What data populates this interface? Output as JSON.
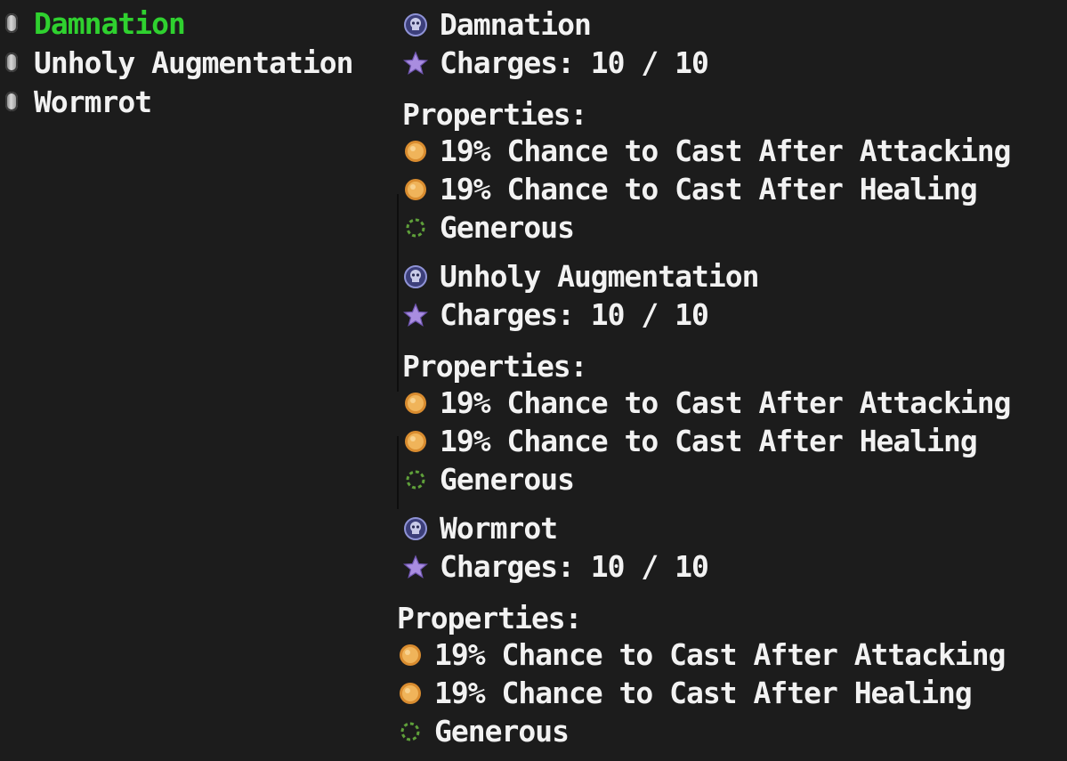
{
  "sidebar": {
    "items": [
      {
        "label": "Damnation",
        "icon": "grey-capsule-icon",
        "active": true
      },
      {
        "label": "Unholy Augmentation",
        "icon": "grey-capsule-icon",
        "active": false
      },
      {
        "label": "Wormrot",
        "icon": "grey-capsule-icon",
        "active": false
      }
    ]
  },
  "details": [
    {
      "name": "Damnation",
      "name_icon": "skull-orb-icon",
      "charges": "Charges: 10 / 10",
      "charges_icon": "purple-star-icon",
      "properties_heading": "Properties:",
      "properties": [
        {
          "text": "19% Chance to Cast After Attacking",
          "icon": "gold-coin-icon"
        },
        {
          "text": "19% Chance to Cast After Healing",
          "icon": "gold-coin-icon"
        },
        {
          "text": "Generous",
          "icon": "green-ring-icon"
        }
      ]
    },
    {
      "name": "Unholy Augmentation",
      "name_icon": "skull-orb-icon",
      "charges": "Charges: 10 / 10",
      "charges_icon": "purple-star-icon",
      "properties_heading": "Properties:",
      "properties": [
        {
          "text": "19% Chance to Cast After Attacking",
          "icon": "gold-coin-icon"
        },
        {
          "text": "19% Chance to Cast After Healing",
          "icon": "gold-coin-icon"
        },
        {
          "text": "Generous",
          "icon": "green-ring-icon"
        }
      ]
    },
    {
      "name": "Wormrot",
      "name_icon": "skull-orb-icon",
      "charges": "Charges: 10 / 10",
      "charges_icon": "purple-star-icon",
      "properties_heading": "Properties:",
      "properties": [
        {
          "text": "19% Chance to Cast After Attacking",
          "icon": "gold-coin-icon"
        },
        {
          "text": "19% Chance to Cast After Healing",
          "icon": "gold-coin-icon"
        },
        {
          "text": "Generous",
          "icon": "green-ring-icon"
        }
      ]
    }
  ],
  "colors": {
    "background": "#1c1c1c",
    "text": "#f2f2f2",
    "active": "#2fd12f",
    "star": "#a98de0",
    "coin": "#e8a84a",
    "ring": "#5fa03a",
    "orb": "#5b5fa8"
  }
}
